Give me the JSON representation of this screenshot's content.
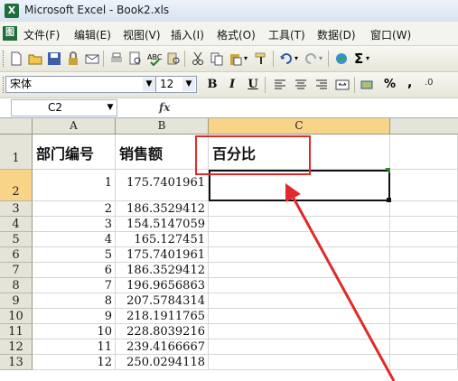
{
  "window": {
    "title": "Microsoft Excel - Book2.xls"
  },
  "menu": {
    "items": [
      "文件(F)",
      "编辑(E)",
      "视图(V)",
      "插入(I)",
      "格式(O)",
      "工具(T)",
      "数据(D)",
      "窗口(W)"
    ]
  },
  "toolbar": {
    "font_name": "宋体",
    "font_size": "12",
    "bold": "B",
    "italic": "I",
    "underline": "U",
    "percent": "%",
    "comma": ","
  },
  "formula_bar": {
    "name_box": "C2",
    "fx": "fx",
    "formula": ""
  },
  "sheet": {
    "columns": [
      "A",
      "B",
      "C"
    ],
    "selected_column": "C",
    "selected_row": "2",
    "header_row": [
      "部门编号",
      "销售额",
      "百分比"
    ],
    "rows": [
      {
        "num": "1",
        "a": "",
        "b": "",
        "c": ""
      },
      {
        "num": "2",
        "a": "1",
        "b": "175.7401961",
        "c": ""
      },
      {
        "num": "3",
        "a": "2",
        "b": "186.3529412",
        "c": ""
      },
      {
        "num": "4",
        "a": "3",
        "b": "154.5147059",
        "c": ""
      },
      {
        "num": "5",
        "a": "4",
        "b": "165.127451",
        "c": ""
      },
      {
        "num": "6",
        "a": "5",
        "b": "175.7401961",
        "c": ""
      },
      {
        "num": "7",
        "a": "6",
        "b": "186.3529412",
        "c": ""
      },
      {
        "num": "8",
        "a": "7",
        "b": "196.9656863",
        "c": ""
      },
      {
        "num": "9",
        "a": "8",
        "b": "207.5784314",
        "c": ""
      },
      {
        "num": "10",
        "a": "9",
        "b": "218.1911765",
        "c": ""
      },
      {
        "num": "11",
        "a": "10",
        "b": "228.8039216",
        "c": ""
      },
      {
        "num": "12",
        "a": "11",
        "b": "239.4166667",
        "c": ""
      },
      {
        "num": "13",
        "a": "12",
        "b": "250.0294118",
        "c": ""
      }
    ]
  },
  "annotation": {
    "color": "#e02a2a"
  }
}
